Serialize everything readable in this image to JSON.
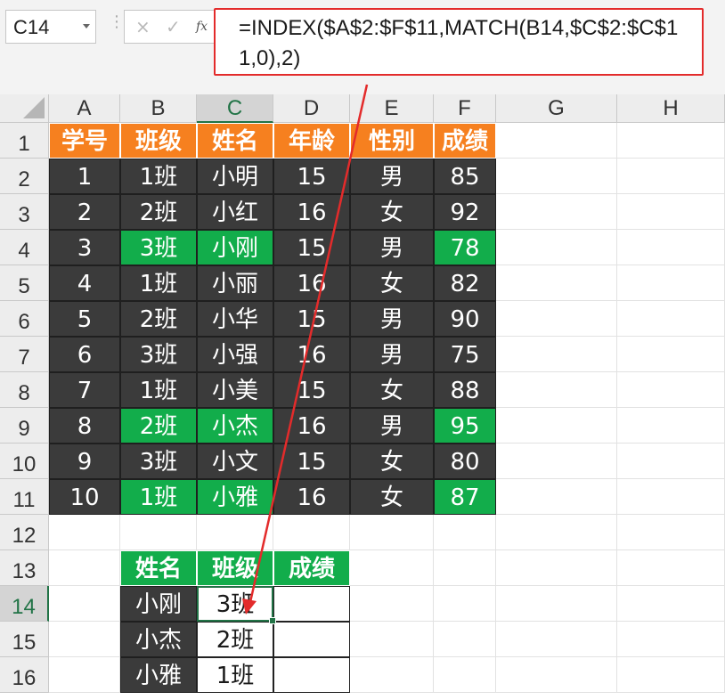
{
  "name_box": {
    "value": "C14"
  },
  "formula_bar": {
    "cancel_icon": "×",
    "enter_icon": "✓",
    "fx_label": "fx",
    "formula": "=INDEX($A$2:$F$11,MATCH(B14,$C$2:$C$11,0),2)"
  },
  "column_headers": [
    "A",
    "B",
    "C",
    "D",
    "E",
    "F",
    "G",
    "H"
  ],
  "row_headers": [
    "1",
    "2",
    "3",
    "4",
    "5",
    "6",
    "7",
    "8",
    "9",
    "10",
    "11",
    "12",
    "13",
    "14",
    "15",
    "16"
  ],
  "active_cell": {
    "column": "C",
    "row": "14"
  },
  "main_table": {
    "headers": [
      "学号",
      "班级",
      "姓名",
      "年龄",
      "性别",
      "成绩"
    ],
    "rows": [
      [
        "1",
        "1班",
        "小明",
        "15",
        "男",
        "85"
      ],
      [
        "2",
        "2班",
        "小红",
        "16",
        "女",
        "92"
      ],
      [
        "3",
        "3班",
        "小刚",
        "15",
        "男",
        "78"
      ],
      [
        "4",
        "1班",
        "小丽",
        "16",
        "女",
        "82"
      ],
      [
        "5",
        "2班",
        "小华",
        "15",
        "男",
        "90"
      ],
      [
        "6",
        "3班",
        "小强",
        "16",
        "男",
        "75"
      ],
      [
        "7",
        "1班",
        "小美",
        "15",
        "女",
        "88"
      ],
      [
        "8",
        "2班",
        "小杰",
        "16",
        "男",
        "95"
      ],
      [
        "9",
        "3班",
        "小文",
        "15",
        "女",
        "80"
      ],
      [
        "10",
        "1班",
        "小雅",
        "16",
        "女",
        "87"
      ]
    ],
    "highlighted_rows": [
      2,
      7,
      9
    ]
  },
  "lookup_table": {
    "headers": [
      "姓名",
      "班级",
      "成绩"
    ],
    "rows": [
      [
        "小刚",
        "3班",
        ""
      ],
      [
        "小杰",
        "2班",
        ""
      ],
      [
        "小雅",
        "1班",
        ""
      ]
    ]
  },
  "colors": {
    "header_orange": "#f6801f",
    "dark_cell": "#3b3b3b",
    "highlight_green": "#12ad4b",
    "annotation_red": "#e32b2b",
    "excel_green": "#217346"
  }
}
